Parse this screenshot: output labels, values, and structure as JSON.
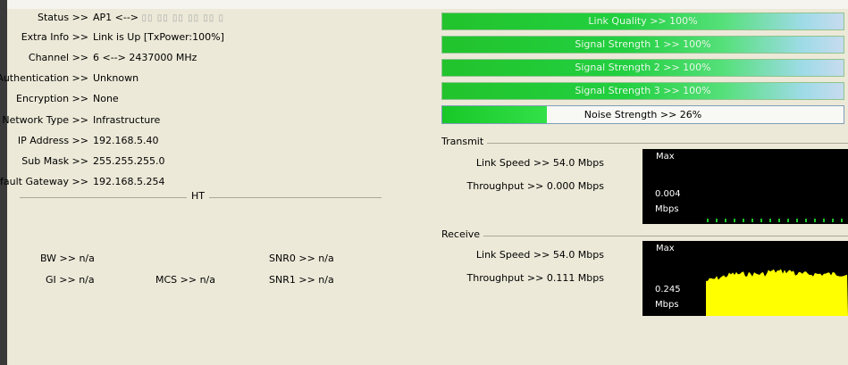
{
  "status": {
    "status_label": "Status >>",
    "status_value": "AP1 <--> ",
    "extra_label": "Extra Info >>",
    "extra_value": "Link is Up [TxPower:100%]",
    "channel_label": "Channel >>",
    "channel_value": "6 <--> 2437000 MHz",
    "auth_label": "Authentication >>",
    "auth_value": "Unknown",
    "enc_label": "Encryption >>",
    "enc_value": "None",
    "nettype_label": "Network Type >>",
    "nettype_value": "Infrastructure",
    "ip_label": "IP Address >>",
    "ip_value": "192.168.5.40",
    "mask_label": "Sub Mask >>",
    "mask_value": "255.255.255.0",
    "gw_label": "Default Gateway >>",
    "gw_value": "192.168.5.254"
  },
  "ht": {
    "title": "HT",
    "bw": "BW >> n/a",
    "gi": "GI >> n/a",
    "mcs": "MCS >> n/a",
    "snr0": "SNR0 >> n/a",
    "snr1": "SNR1 >> n/a"
  },
  "bars": {
    "link_quality": "Link Quality >> 100%",
    "signal1": "Signal Strength 1 >> 100%",
    "signal2": "Signal Strength 2 >> 100%",
    "signal3": "Signal Strength 3 >> 100%",
    "noise": "Noise Strength >> 26%",
    "noise_fraction": 0.26,
    "green": "#22c32c"
  },
  "transmit": {
    "title": "Transmit",
    "link_speed": "Link Speed >> 54.0 Mbps",
    "throughput": "Throughput >> 0.000 Mbps",
    "graph_max": "Max",
    "graph_value": "0.004",
    "graph_unit": "Mbps"
  },
  "receive": {
    "title": "Receive",
    "link_speed": "Link Speed >> 54.0 Mbps",
    "throughput": "Throughput >> 0.111 Mbps",
    "graph_max": "Max",
    "graph_value": "0.245",
    "graph_unit": "Mbps",
    "graph_color": "#ffff00"
  }
}
